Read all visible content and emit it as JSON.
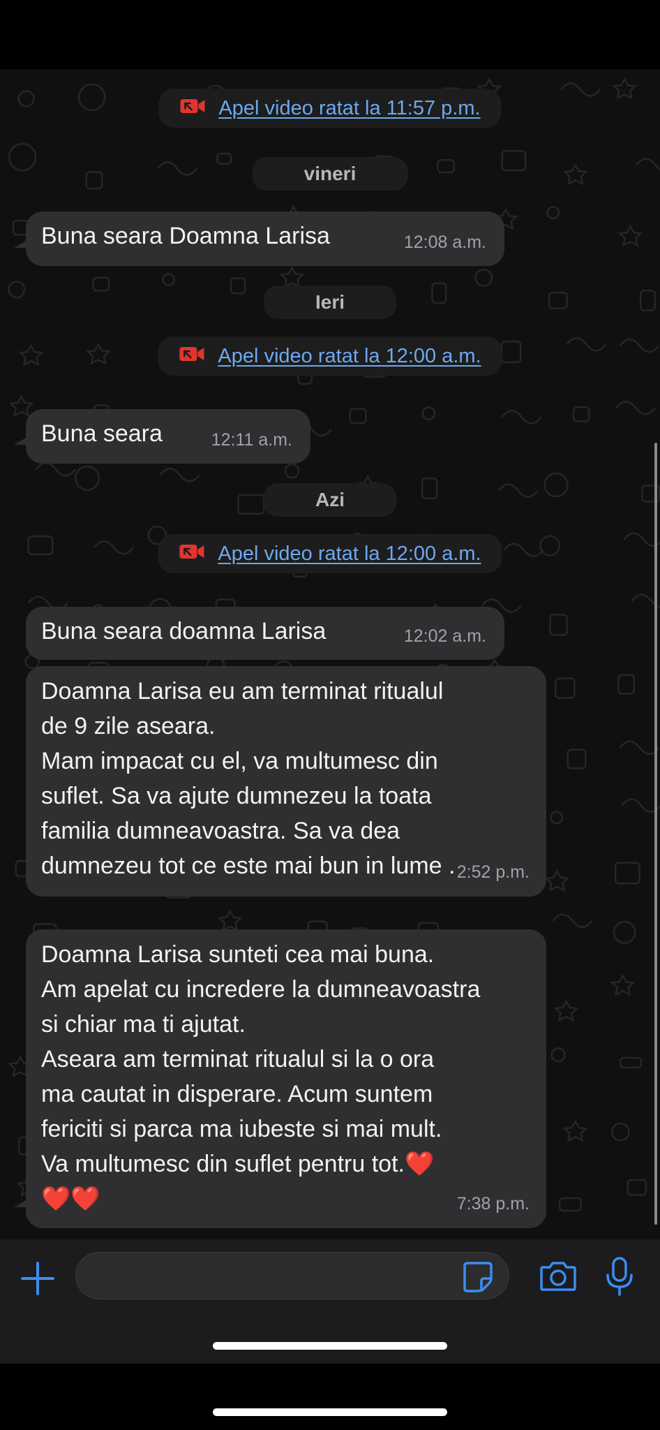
{
  "chat": {
    "items": [
      {
        "type": "missed_call",
        "text": "Apel video ratat la 11:57 p.m."
      },
      {
        "type": "day",
        "text": "vineri"
      },
      {
        "type": "message",
        "text": "Buna seara Doamna Larisa",
        "time": "12:08 a.m."
      },
      {
        "type": "day",
        "text": "Ieri"
      },
      {
        "type": "missed_call",
        "text": "Apel video ratat la 12:00 a.m."
      },
      {
        "type": "message",
        "text": "Buna seara",
        "time": "12:11 a.m."
      },
      {
        "type": "day",
        "text": "Azi"
      },
      {
        "type": "missed_call",
        "text": "Apel video ratat la 12:00 a.m."
      },
      {
        "type": "message",
        "text": "Buna seara doamna  Larisa",
        "time": "12:02 a.m."
      },
      {
        "type": "message",
        "text": "Doamna Larisa eu am terminat ritualul\nde 9 zile aseara.\nMam impacat cu el, va multumesc din\nsuflet. Sa va ajute dumnezeu la toata\nfamilia dumneavoastra. Sa va dea\ndumnezeu tot ce este mai bun in lume .",
        "time": "2:52 p.m."
      },
      {
        "type": "message",
        "text": "Doamna Larisa sunteti cea mai buna.\nAm apelat cu incredere la dumneavoastra\nsi chiar ma ti ajutat.\nAseara am terminat ritualul si la o ora\nma cautat in disperare. Acum suntem\nfericiti si parca ma iubeste si mai mult.\nVa multumesc din suflet pentru tot.❤️\n❤️❤️",
        "time": "7:38 p.m."
      }
    ]
  },
  "compose": {
    "input_value": "",
    "icons": [
      "plus-icon",
      "sticker-icon",
      "camera-icon",
      "microphone-icon"
    ]
  },
  "colors": {
    "accent": "#3a8ef0",
    "missed_call_icon": "#e0362f",
    "bubble": "#2f2f31",
    "chat_background": "#101010"
  }
}
